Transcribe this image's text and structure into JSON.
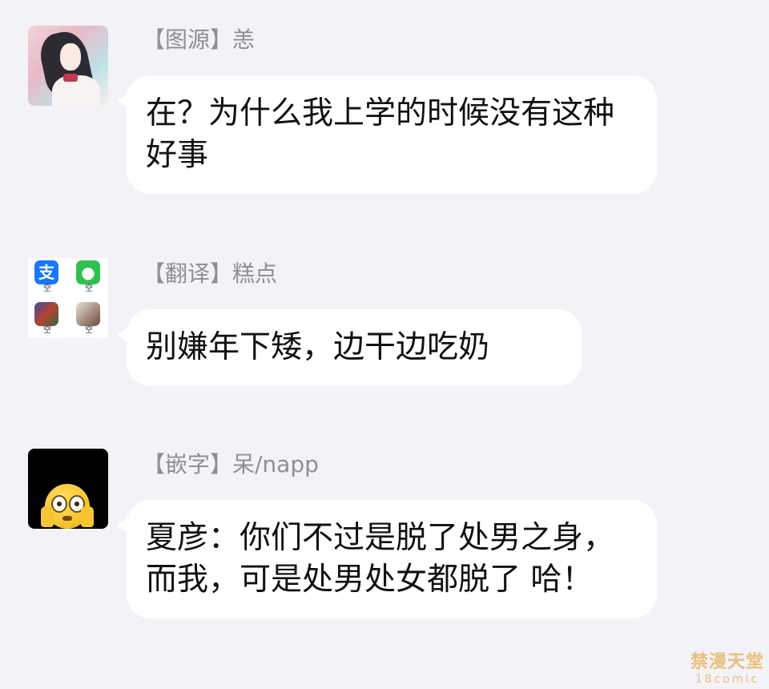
{
  "messages": [
    {
      "sender": "【图源】恙",
      "text": "在？为什么我上学的时候没有这种好事",
      "avatar_icon": "anime-girl-avatar"
    },
    {
      "sender": "【翻译】糕点",
      "text": "别嫌年下矮，边干边吃奶",
      "avatar_icon": "app-grid-avatar",
      "avatar_grid_caption": "空",
      "avatar_grid_glyphs": [
        "支",
        "●"
      ]
    },
    {
      "sender": "【嵌字】呆/napp",
      "text": "夏彦：你们不过是脱了处男之身，而我，可是处男处女都脱了 哈！",
      "avatar_icon": "flushed-emoji-avatar"
    }
  ],
  "watermark": {
    "top": "禁漫天堂",
    "bottom": "18comic"
  },
  "colors": {
    "background": "#f2f2f7",
    "bubble": "#ffffff",
    "sender_text": "#8e8e93",
    "message_text": "#111111"
  }
}
